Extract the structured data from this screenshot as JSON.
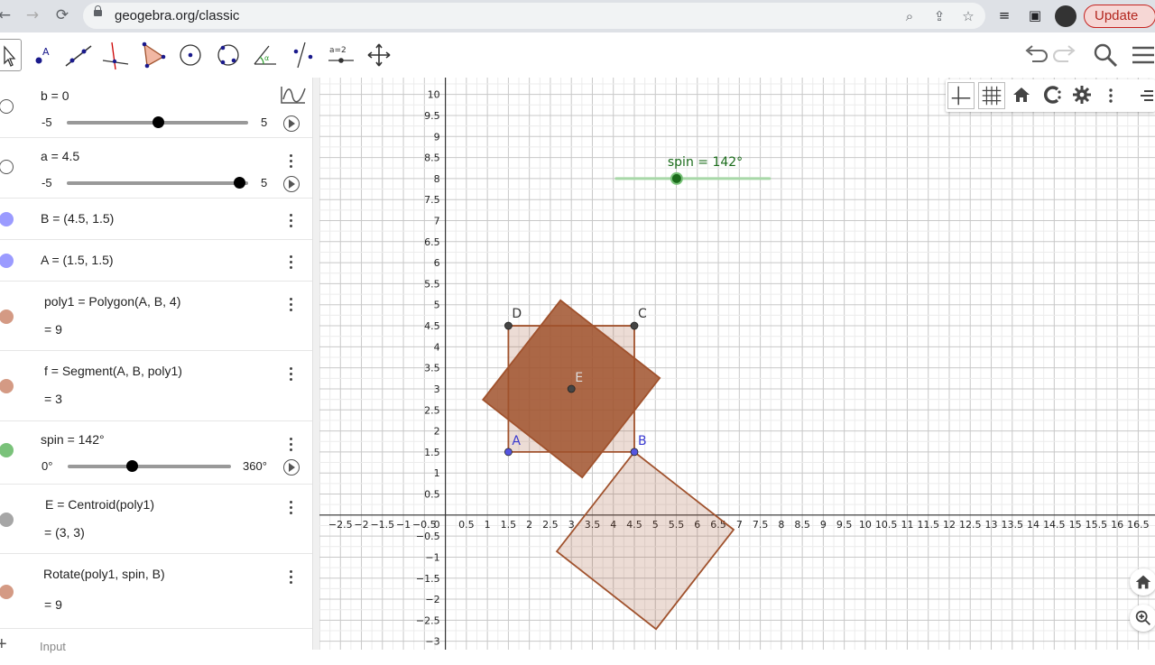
{
  "browser": {
    "url": "geogebra.org/classic",
    "update_label": "Update",
    "back_icon": "back-arrow-icon",
    "forward_icon": "forward-arrow-icon",
    "reload_icon": "reload-icon"
  },
  "toolbar": {
    "tools": [
      "move-tool",
      "point-tool",
      "line-tool",
      "perpendicular-tool",
      "polygon-tool",
      "circle-center-tool",
      "circle-3points-tool",
      "angle-tool",
      "reflect-tool",
      "slider-tool",
      "move-view-tool"
    ],
    "slider_tool_label": "a=2"
  },
  "algebra": {
    "items": [
      {
        "text": "b = 0",
        "kind": "slider",
        "min": "-5",
        "max": "5",
        "value": 0,
        "dot": "#ffffff"
      },
      {
        "text": "a = 4.5",
        "kind": "slider",
        "min": "-5",
        "max": "5",
        "value": 4.5,
        "dot": "#ffffff"
      },
      {
        "text": "B = (4.5, 1.5)",
        "kind": "point",
        "dot": "#9b9bff"
      },
      {
        "text": "A = (1.5, 1.5)",
        "kind": "point",
        "dot": "#9b9bff"
      },
      {
        "text": "poly1  =  Polygon(A, B, 4)",
        "result": "=  9",
        "kind": "def",
        "dot": "#d49a84"
      },
      {
        "text": "f  =  Segment(A, B, poly1)",
        "result": "=  3",
        "kind": "def",
        "dot": "#d49a84"
      },
      {
        "text": "spin = 142°",
        "kind": "slider",
        "min": "0°",
        "max": "360°",
        "value": 142,
        "dot": "#7ac27a"
      },
      {
        "text": "E  =  Centroid(poly1)",
        "result": "=  (3, 3)",
        "kind": "def",
        "dot": "#a6a6a6"
      },
      {
        "text": "Rotate(poly1, spin, B)",
        "result": "=  9",
        "kind": "def",
        "dot": "#d49a84"
      }
    ],
    "input_placeholder": "Input"
  },
  "graphics": {
    "spin_label": "spin = 142°",
    "spin_value": 142,
    "points": [
      {
        "name": "A",
        "x": 1.5,
        "y": 1.5,
        "color": "#3a3ad0"
      },
      {
        "name": "B",
        "x": 4.5,
        "y": 1.5,
        "color": "#3a3ad0"
      },
      {
        "name": "C",
        "x": 4.5,
        "y": 4.5,
        "color": "#333333"
      },
      {
        "name": "D",
        "x": 1.5,
        "y": 4.5,
        "color": "#333333"
      },
      {
        "name": "E",
        "x": 3,
        "y": 3,
        "color": "#333333"
      }
    ],
    "square_color": "#a0522d",
    "x_ticks": [
      "−2.5",
      "−2",
      "−1.5",
      "−1",
      "−0.5",
      "0",
      "0.5",
      "1",
      "1.5",
      "2",
      "2.5",
      "3",
      "3.5",
      "4",
      "4.5",
      "5",
      "5.5",
      "6",
      "6.5",
      "7",
      "7.5",
      "8",
      "8.5",
      "9",
      "9.5",
      "10",
      "10.5",
      "11",
      "11.5",
      "12",
      "12.5",
      "13",
      "13.5",
      "14",
      "14.5",
      "15",
      "15.5",
      "16",
      "16.5"
    ],
    "y_ticks": [
      "−3",
      "−2.5",
      "−2",
      "−1.5",
      "−1",
      "−0.5",
      "0.5",
      "1",
      "1.5",
      "2",
      "2.5",
      "3",
      "3.5",
      "4",
      "4.5",
      "5",
      "5.5",
      "6",
      "6.5",
      "7",
      "7.5",
      "8",
      "8.5",
      "9",
      "9.5",
      "10"
    ],
    "xmin": -3.0,
    "xmax": 16.9,
    "ymin": -3.2,
    "ymax": 10.4
  },
  "stylebar": {
    "icons": [
      "axes-icon",
      "grid-icon",
      "home-icon",
      "capture-icon",
      "gear-icon",
      "more-vertical-icon",
      "collapse-icon"
    ]
  }
}
